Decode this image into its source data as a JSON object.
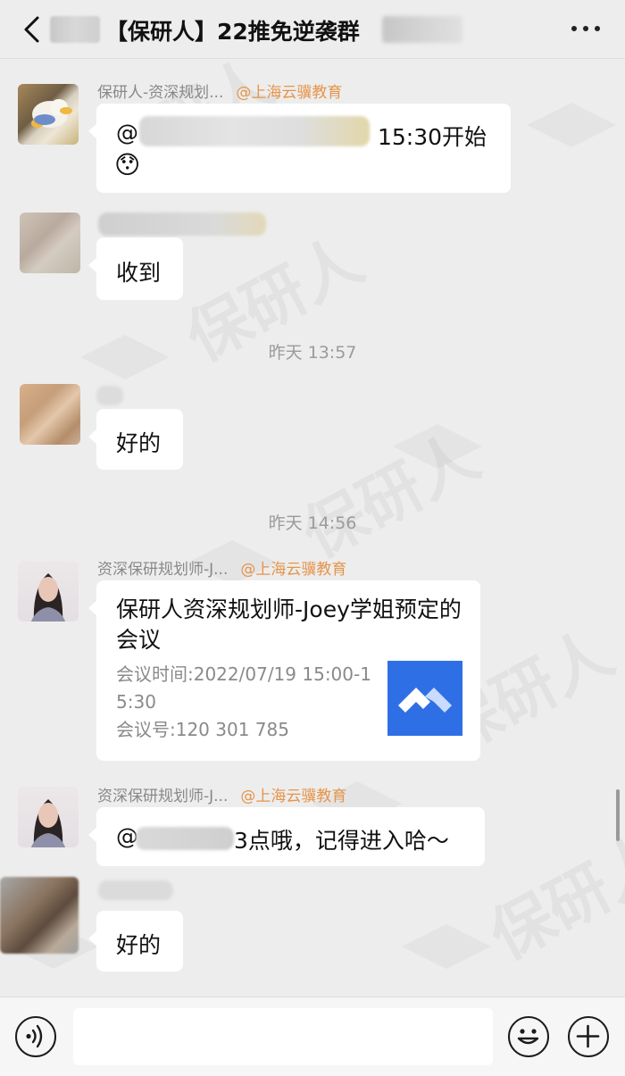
{
  "header": {
    "title": "【保研人】22推免逆袭群",
    "more_icon": "more-horizontal-icon",
    "back_icon": "chevron-left-icon"
  },
  "watermark": {
    "text": "保研人"
  },
  "messages": [
    {
      "sender": "保研人-资深规划...",
      "org": "@上海云骥教育",
      "text_prefix": "@",
      "text_suffix": "15:30开始",
      "emoji": "😯"
    },
    {
      "text": "收到"
    },
    {
      "text": "好的"
    },
    {
      "sender": "资深保研规划师-J...",
      "org": "@上海云骥教育",
      "card": {
        "title": "保研人资深规划师-Joey学姐预定的会议",
        "time": "会议时间:2022/07/19 15:00-15:30",
        "id": "会议号:120 301 785"
      }
    },
    {
      "sender": "资深保研规划师-J...",
      "org": "@上海云骥教育",
      "text_prefix": "@",
      "text_suffix": "3点哦，记得进入哈～"
    },
    {
      "text": "好的"
    }
  ],
  "timestamps": [
    "昨天 13:57",
    "昨天 14:56"
  ],
  "bottom": {
    "voice_icon": "voice-icon",
    "emoji_icon": "smiley-icon",
    "plus_icon": "plus-icon"
  },
  "colors": {
    "background": "#ededed",
    "org_accent": "#e5944a",
    "meeting_logo": "#2f6fe6"
  }
}
